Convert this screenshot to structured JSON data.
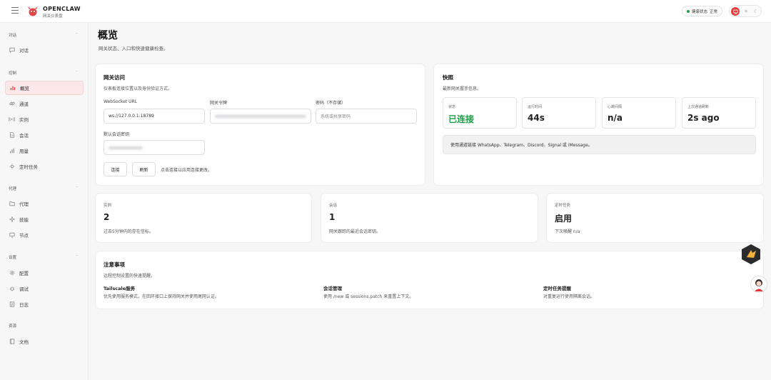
{
  "brand": {
    "title": "OPENCLAW",
    "subtitle": "网关仪表盘"
  },
  "header": {
    "health_label": "健康状态",
    "health_value": "正常",
    "status_color": "#22a54a",
    "accent": "#e23b3b"
  },
  "sidebar": {
    "groups": [
      {
        "label": "对话",
        "items": [
          {
            "label": "对话",
            "icon": "chat-bubble-icon"
          }
        ]
      },
      {
        "label": "控制",
        "items": [
          {
            "label": "概览",
            "icon": "bar-chart-icon",
            "active": true
          },
          {
            "label": "通道",
            "icon": "link-icon"
          },
          {
            "label": "实例",
            "icon": "radio-icon"
          },
          {
            "label": "会话",
            "icon": "document-icon"
          },
          {
            "label": "用量",
            "icon": "usage-bars-icon"
          },
          {
            "label": "定时任务",
            "icon": "sun-clock-icon"
          }
        ]
      },
      {
        "label": "代理",
        "items": [
          {
            "label": "代理",
            "icon": "folder-icon"
          },
          {
            "label": "技能",
            "icon": "sparkle-icon"
          },
          {
            "label": "节点",
            "icon": "monitor-icon"
          }
        ]
      },
      {
        "label": "设置",
        "items": [
          {
            "label": "配置",
            "icon": "gear-icon"
          },
          {
            "label": "调试",
            "icon": "bug-icon"
          },
          {
            "label": "日志",
            "icon": "log-file-icon"
          }
        ]
      },
      {
        "label": "资源",
        "items": [
          {
            "label": "文档",
            "icon": "book-icon"
          }
        ]
      }
    ]
  },
  "page": {
    "title": "概览",
    "subtitle": "网关状态、入口和快速健康检查。"
  },
  "gateway": {
    "title": "网关访问",
    "description": "仪表板连接位置以及身份验证方式。",
    "ws_label": "WebSocket URL",
    "ws_value": "ws://127.0.0.1:18789",
    "token_label": "网关令牌",
    "password_label": "密码（不存储）",
    "password_placeholder": "系统或共享密码",
    "session_key_label": "默认会话密钥",
    "connect_button": "连接",
    "refresh_button": "刷新",
    "hint": "点击连接以应用连接更改。"
  },
  "snapshot": {
    "title": "快照",
    "description": "最新网关握手信息。",
    "stats": [
      {
        "label": "状态",
        "value": "已连接",
        "green": true
      },
      {
        "label": "运行时间",
        "value": "44s"
      },
      {
        "label": "心跳间隔",
        "value": "n/a"
      },
      {
        "label": "上次通道刷新",
        "value": "2s ago"
      }
    ],
    "info": "使用通道链接 WhatsApp、Telegram、Discord、Signal 或 iMessage。"
  },
  "cards": [
    {
      "label": "实例",
      "value": "2",
      "desc": "过去5分钟内的存在信标。"
    },
    {
      "label": "会话",
      "value": "1",
      "desc": "网关跟踪的最近会话密钥。"
    },
    {
      "label": "定时任务",
      "value": "启用",
      "desc": "下次唤醒 n/a"
    }
  ],
  "notes": {
    "title": "注意事项",
    "description": "远程控制设置的快速提醒。",
    "items": [
      {
        "title": "Tailscale服务",
        "text": "优先使用服务模式，在回环接口上保持网关并使用尾网认证。"
      },
      {
        "title": "会话管理",
        "text": "使用 /new 或 sessions.patch 来重置上下文。"
      },
      {
        "title": "定时任务提醒",
        "text": "对重复运行使用隔离会话。"
      }
    ]
  }
}
